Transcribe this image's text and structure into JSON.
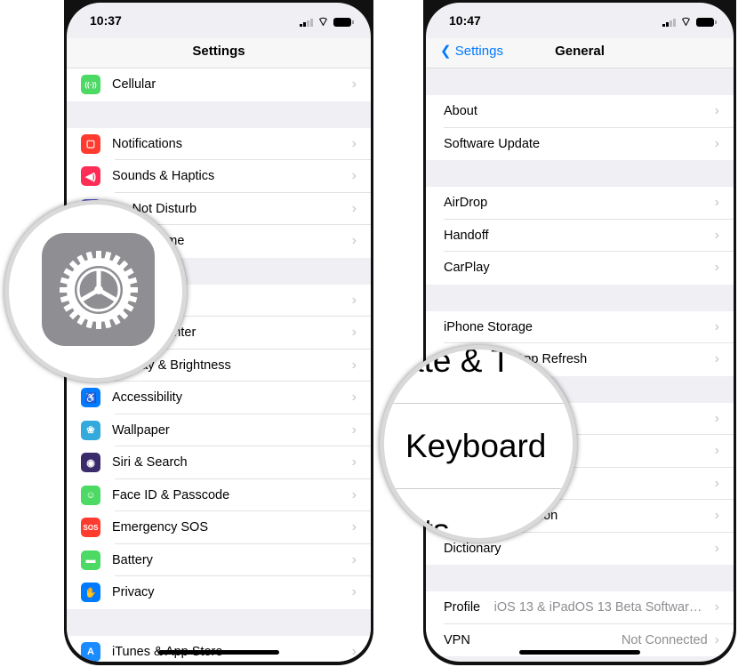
{
  "left_phone": {
    "status": {
      "time": "10:37"
    },
    "title": "Settings",
    "groups": [
      [
        {
          "label": "Cellular",
          "icon": "cellular-icon",
          "color": "#4cd964",
          "glyph": "((·))"
        }
      ],
      [
        {
          "label": "Notifications",
          "icon": "notifications-icon",
          "color": "#ff3b30",
          "glyph": "▢"
        },
        {
          "label": "Sounds & Haptics",
          "icon": "sounds-icon",
          "color": "#ff2d55",
          "glyph": "◀)"
        },
        {
          "label": "Do Not Disturb",
          "icon": "moon-icon",
          "color": "#5856d6",
          "glyph": "☾"
        },
        {
          "label": "Screen Time",
          "icon": "hourglass-icon",
          "color": "#5856d6",
          "glyph": "⧗"
        }
      ],
      [
        {
          "label": "General",
          "icon": "gear-icon",
          "color": "#8e8e93",
          "glyph": "⚙"
        },
        {
          "label": "Control Center",
          "icon": "toggles-icon",
          "color": "#8e8e93",
          "glyph": "≡"
        },
        {
          "label": "Display & Brightness",
          "icon": "display-icon",
          "color": "#007aff",
          "glyph": "AA"
        },
        {
          "label": "Accessibility",
          "icon": "accessibility-icon",
          "color": "#007aff",
          "glyph": "♿"
        },
        {
          "label": "Wallpaper",
          "icon": "wallpaper-icon",
          "color": "#34aadc",
          "glyph": "❀"
        },
        {
          "label": "Siri & Search",
          "icon": "siri-icon",
          "color": "#3a2b6b",
          "glyph": "◉"
        },
        {
          "label": "Face ID & Passcode",
          "icon": "face-id-icon",
          "color": "#4cd964",
          "glyph": "☺"
        },
        {
          "label": "Emergency SOS",
          "icon": "sos-icon",
          "color": "#ff3b30",
          "glyph": "SOS"
        },
        {
          "label": "Battery",
          "icon": "battery-icon",
          "color": "#4cd964",
          "glyph": "▬"
        },
        {
          "label": "Privacy",
          "icon": "hand-icon",
          "color": "#007aff",
          "glyph": "✋"
        }
      ],
      [
        {
          "label": "iTunes & App Store",
          "icon": "app-store-icon",
          "color": "#1a8cff",
          "glyph": "A"
        }
      ]
    ]
  },
  "right_phone": {
    "status": {
      "time": "10:47"
    },
    "back_label": "Settings",
    "title": "General",
    "groups": [
      [
        {
          "label": "About"
        },
        {
          "label": "Software Update"
        }
      ],
      [
        {
          "label": "AirDrop"
        },
        {
          "label": "Handoff"
        },
        {
          "label": "CarPlay"
        }
      ],
      [
        {
          "label": "iPhone Storage"
        },
        {
          "label": "Background App Refresh"
        }
      ],
      [
        {
          "label": "Date & Time"
        },
        {
          "label": "Keyboard"
        },
        {
          "label": "Fonts"
        },
        {
          "label": "Language & Region"
        },
        {
          "label": "Dictionary"
        }
      ],
      [
        {
          "label": "Profile",
          "value": "iOS 13 & iPadOS 13 Beta Software Pr..."
        },
        {
          "label": "VPN",
          "value": "Not Connected"
        }
      ]
    ]
  },
  "magnifier_keyboard": {
    "top": "ate & T",
    "middle": "Keyboard",
    "bottom": "nts"
  }
}
